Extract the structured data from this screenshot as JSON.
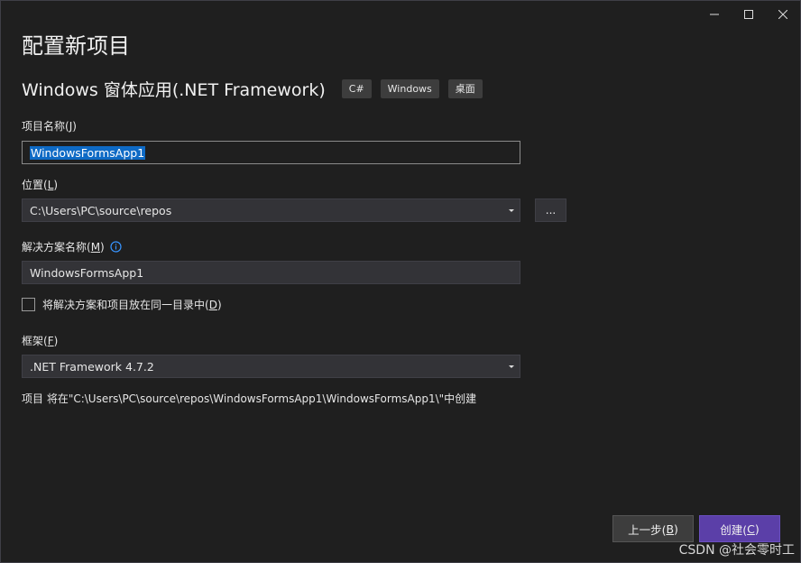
{
  "window": {
    "controls": {
      "minimize": "—",
      "maximize": "☐",
      "close": "✕"
    }
  },
  "page": {
    "title": "配置新项目",
    "template_name": "Windows 窗体应用(.NET Framework)",
    "tags": [
      "C#",
      "Windows",
      "桌面"
    ]
  },
  "form": {
    "project_name": {
      "label_pre": "项目名称(",
      "label_key": "J",
      "label_post": ")",
      "value": "WindowsFormsApp1"
    },
    "location": {
      "label_pre": "位置(",
      "label_key": "L",
      "label_post": ")",
      "value": "C:\\Users\\PC\\source\\repos",
      "browse_label": "..."
    },
    "solution_name": {
      "label_pre": "解决方案名称(",
      "label_key": "M",
      "label_post": ")",
      "value": "WindowsFormsApp1"
    },
    "same_dir": {
      "label_pre": "将解决方案和项目放在同一目录中(",
      "label_key": "D",
      "label_post": ")",
      "checked": false
    },
    "framework": {
      "label_pre": "框架(",
      "label_key": "F",
      "label_post": ")",
      "value": ".NET Framework 4.7.2"
    },
    "path_summary": "项目 将在\"C:\\Users\\PC\\source\\repos\\WindowsFormsApp1\\WindowsFormsApp1\\\"中创建"
  },
  "footer": {
    "back_label_pre": "上一步(",
    "back_label_key": "B",
    "back_label_post": ")",
    "create_label_pre": "创建(",
    "create_label_key": "C",
    "create_label_post": ")"
  },
  "watermark": "CSDN @社会零时工",
  "colors": {
    "background": "#1f1f1f",
    "accent_button": "#5b3fa8",
    "selection": "#0e6ac5",
    "info_icon": "#3794ff"
  }
}
